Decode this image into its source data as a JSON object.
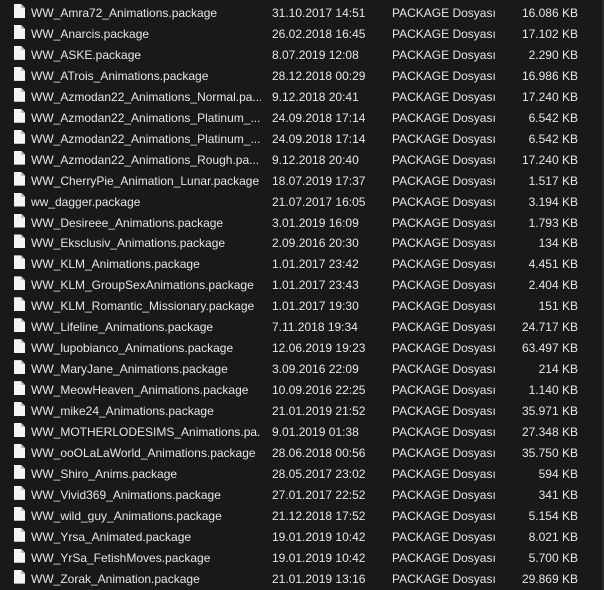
{
  "files": [
    {
      "name": "WW_Amra72_Animations.package",
      "date": "31.10.2017 14:51",
      "type": "PACKAGE Dosyası",
      "size": "16.086 KB"
    },
    {
      "name": "WW_Anarcis.package",
      "date": "26.02.2018 16:45",
      "type": "PACKAGE Dosyası",
      "size": "17.102 KB"
    },
    {
      "name": "WW_ASKE.package",
      "date": "8.07.2019 12:08",
      "type": "PACKAGE Dosyası",
      "size": "2.290 KB"
    },
    {
      "name": "WW_ATrois_Animations.package",
      "date": "28.12.2018 00:29",
      "type": "PACKAGE Dosyası",
      "size": "16.986 KB"
    },
    {
      "name": "WW_Azmodan22_Animations_Normal.pa...",
      "date": "9.12.2018 20:41",
      "type": "PACKAGE Dosyası",
      "size": "17.240 KB"
    },
    {
      "name": "WW_Azmodan22_Animations_Platinum_...",
      "date": "24.09.2018 17:14",
      "type": "PACKAGE Dosyası",
      "size": "6.542 KB"
    },
    {
      "name": "WW_Azmodan22_Animations_Platinum_...",
      "date": "24.09.2018 17:14",
      "type": "PACKAGE Dosyası",
      "size": "6.542 KB"
    },
    {
      "name": "WW_Azmodan22_Animations_Rough.pa...",
      "date": "9.12.2018 20:40",
      "type": "PACKAGE Dosyası",
      "size": "17.240 KB"
    },
    {
      "name": "WW_CherryPie_Animation_Lunar.package",
      "date": "18.07.2019 17:37",
      "type": "PACKAGE Dosyası",
      "size": "1.517 KB"
    },
    {
      "name": "ww_dagger.package",
      "date": "21.07.2017 16:05",
      "type": "PACKAGE Dosyası",
      "size": "3.194 KB"
    },
    {
      "name": "WW_Desireee_Animations.package",
      "date": "3.01.2019 16:09",
      "type": "PACKAGE Dosyası",
      "size": "1.793 KB"
    },
    {
      "name": "WW_Eksclusiv_Animations.package",
      "date": "2.09.2016 20:30",
      "type": "PACKAGE Dosyası",
      "size": "134 KB"
    },
    {
      "name": "WW_KLM_Animations.package",
      "date": "1.01.2017 23:42",
      "type": "PACKAGE Dosyası",
      "size": "4.451 KB"
    },
    {
      "name": "WW_KLM_GroupSexAnimations.package",
      "date": "1.01.2017 23:43",
      "type": "PACKAGE Dosyası",
      "size": "2.404 KB"
    },
    {
      "name": "WW_KLM_Romantic_Missionary.package",
      "date": "1.01.2017 19:30",
      "type": "PACKAGE Dosyası",
      "size": "151 KB"
    },
    {
      "name": "WW_Lifeline_Animations.package",
      "date": "7.11.2018 19:34",
      "type": "PACKAGE Dosyası",
      "size": "24.717 KB"
    },
    {
      "name": "WW_lupobianco_Animations.package",
      "date": "12.06.2019 19:23",
      "type": "PACKAGE Dosyası",
      "size": "63.497 KB"
    },
    {
      "name": "WW_MaryJane_Animations.package",
      "date": "3.09.2016 22:09",
      "type": "PACKAGE Dosyası",
      "size": "214 KB"
    },
    {
      "name": "WW_MeowHeaven_Animations.package",
      "date": "10.09.2016 22:25",
      "type": "PACKAGE Dosyası",
      "size": "1.140 KB"
    },
    {
      "name": "WW_mike24_Animations.package",
      "date": "21.01.2019 21:52",
      "type": "PACKAGE Dosyası",
      "size": "35.971 KB"
    },
    {
      "name": "WW_MOTHERLODESIMS_Animations.pa...",
      "date": "9.01.2019 01:38",
      "type": "PACKAGE Dosyası",
      "size": "27.348 KB"
    },
    {
      "name": "WW_ooOLaLaWorld_Animations.package",
      "date": "28.06.2018 00:56",
      "type": "PACKAGE Dosyası",
      "size": "35.750 KB"
    },
    {
      "name": "WW_Shiro_Anims.package",
      "date": "28.05.2017 23:02",
      "type": "PACKAGE Dosyası",
      "size": "594 KB"
    },
    {
      "name": "WW_Vivid369_Animations.package",
      "date": "27.01.2017 22:52",
      "type": "PACKAGE Dosyası",
      "size": "341 KB"
    },
    {
      "name": "WW_wild_guy_Animations.package",
      "date": "21.12.2018 17:52",
      "type": "PACKAGE Dosyası",
      "size": "5.154 KB"
    },
    {
      "name": "WW_Yrsa_Animated.package",
      "date": "19.01.2019 10:42",
      "type": "PACKAGE Dosyası",
      "size": "8.021 KB"
    },
    {
      "name": "WW_YrSa_FetishMoves.package",
      "date": "19.01.2019 10:42",
      "type": "PACKAGE Dosyası",
      "size": "5.700 KB"
    },
    {
      "name": "WW_Zorak_Animation.package",
      "date": "21.01.2019 13:16",
      "type": "PACKAGE Dosyası",
      "size": "29.869 KB"
    }
  ],
  "colors": {
    "background": "#191919",
    "text": "#e6e6e6",
    "file_icon": "#f4f4f4"
  },
  "icons": {
    "file": "document-icon"
  }
}
